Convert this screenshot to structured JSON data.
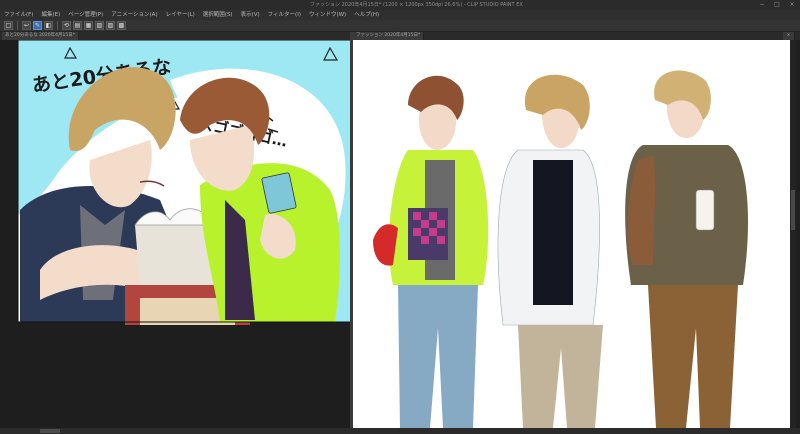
{
  "window": {
    "title": "ファッション 2020年4月15日* (1200 × 1200px 350dpi 26.6%) - CLIP STUDIO PAINT EX",
    "minimize_glyph": "−",
    "maximize_glyph": "□",
    "close_glyph": "×"
  },
  "menu": {
    "items": [
      "ファイル(F)",
      "編集(E)",
      "ページ管理(P)",
      "アニメーション(A)",
      "レイヤー(L)",
      "選択範囲(S)",
      "表示(V)",
      "フィルター(I)",
      "ウィンドウ(W)",
      "ヘルプ(H)"
    ]
  },
  "toolbar": {
    "buttons": [
      "□",
      "↩",
      "✎",
      "◧",
      "⟲",
      "▤",
      "▦",
      "▧",
      "▨",
      "▩"
    ]
  },
  "tabs": {
    "left": "あと20分あるな 2020年4月15日*",
    "right": "ファッション 2020年4月15日*",
    "right_close": "×"
  },
  "canvas_left": {
    "caption_1": "あと20分あるな",
    "caption_2": "ズゴゴゴゴ…",
    "colors": {
      "sky": "#9ee8f4",
      "hoodie": "#b7f22d",
      "hair_blond": "#c9a565",
      "hair_brown": "#9a5a35",
      "navy": "#2c3957"
    }
  },
  "canvas_right": {
    "colors": {
      "hoodie": "#c7f23a",
      "jeans": "#86a9c4",
      "shirt": "#f2f3f5",
      "khaki": "#c2b49a",
      "sweater": "#6b6149",
      "brown_pants": "#8a6235"
    }
  }
}
